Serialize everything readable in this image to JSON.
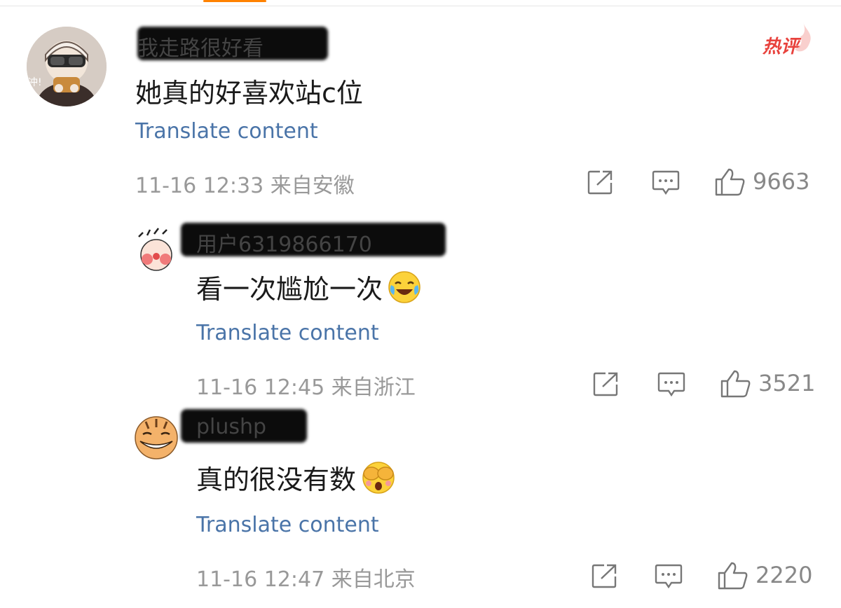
{
  "hot_badge": "热评",
  "translate_label": "Translate content",
  "comments": [
    {
      "username": "我走路很好看",
      "text": "她真的好喜欢站c位",
      "time": "11-16 12:33",
      "location": "来自安徽",
      "likes": "9663",
      "avatar_icon": "helmet-rider-avatar"
    },
    {
      "username": "用户6319866170",
      "text": "看一次尴尬一次",
      "emoji": "laugh-cry-icon",
      "time": "11-16 12:45",
      "location": "来自浙江",
      "likes": "3521",
      "avatar_icon": "cartoon-blush-avatar"
    },
    {
      "username": "plushp",
      "text": "真的很没有数",
      "emoji": "cover-eyes-icon",
      "time": "11-16 12:47",
      "location": "来自北京",
      "likes": "2220",
      "avatar_icon": "tiger-grin-avatar"
    }
  ],
  "colors": {
    "link": "#4a74a8",
    "meta": "#999999",
    "hot": "#e8423d"
  }
}
